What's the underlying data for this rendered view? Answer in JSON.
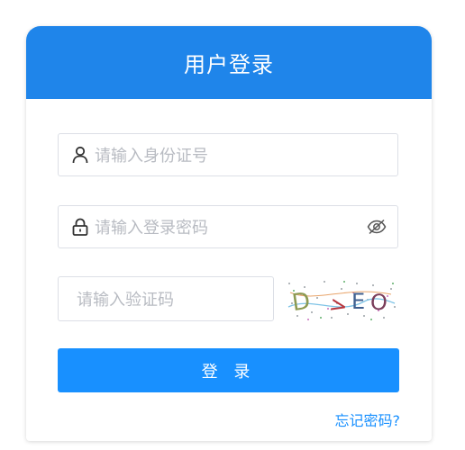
{
  "header": {
    "title": "用户登录"
  },
  "form": {
    "id_placeholder": "请输入身份证号",
    "password_placeholder": "请输入登录密码",
    "captcha_placeholder": "请输入验证码",
    "captcha_text": "D>EO",
    "login_label": "登 录",
    "forgot_label": "忘记密码?"
  },
  "colors": {
    "header_bg": "#1f85ea",
    "primary": "#1890ff",
    "placeholder": "#b8bbc2"
  },
  "icons": {
    "id_field": "user-icon",
    "password_field": "lock-icon",
    "password_toggle": "eye-off-icon"
  }
}
